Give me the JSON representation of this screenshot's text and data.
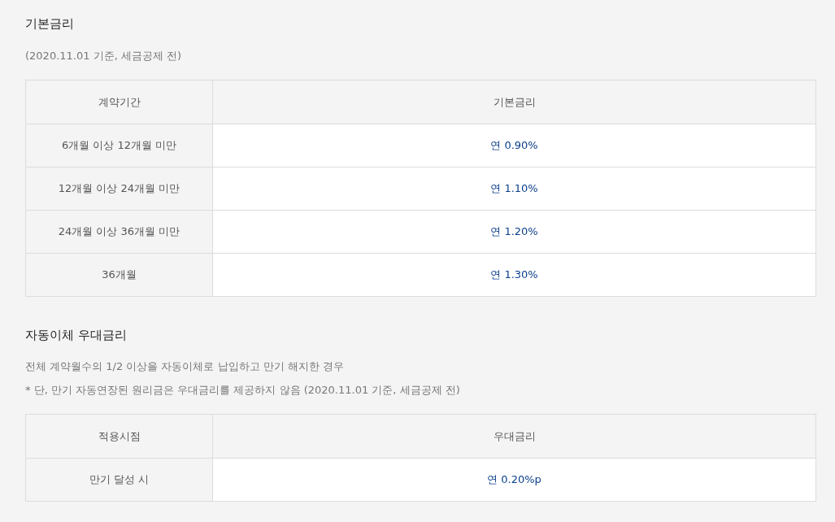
{
  "sections": [
    {
      "title": "기본금리",
      "notes": [
        "(2020.11.01 기준, 세금공제 전)"
      ],
      "table": {
        "columns": [
          "계약기간",
          "기본금리"
        ],
        "rows": [
          [
            "6개월 이상 12개월 미만",
            "연 0.90%"
          ],
          [
            "12개월 이상 24개월 미만",
            "연 1.10%"
          ],
          [
            "24개월 이상 36개월 미만",
            "연 1.20%"
          ],
          [
            "36개월",
            "연 1.30%"
          ]
        ]
      }
    },
    {
      "title": "자동이체 우대금리",
      "notes": [
        "전체 계약월수의 1/2 이상을 자동이체로 납입하고 만기 해지한 경우",
        "* 단, 만기 자동연장된 원리금은 우대금리를 제공하지 않음 (2020.11.01 기준, 세금공제 전)"
      ],
      "table": {
        "columns": [
          "적용시점",
          "우대금리"
        ],
        "rows": [
          [
            "만기 달성 시",
            "연 0.20%p"
          ]
        ]
      }
    }
  ]
}
